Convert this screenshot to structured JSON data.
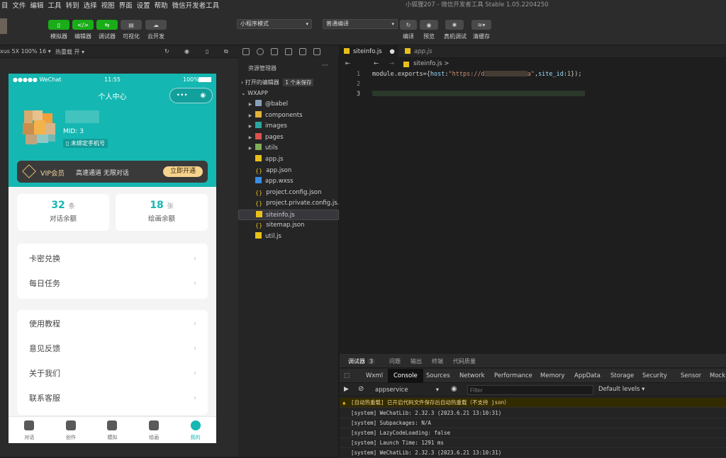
{
  "menubar": {
    "items": [
      "目",
      "文件",
      "编辑",
      "工具",
      "转到",
      "选择",
      "视图",
      "界面",
      "设置",
      "帮助",
      "微信开发者工具"
    ],
    "window_title": "小狐狸207 - 微信开发者工具 Stable 1.05.2204250"
  },
  "toolbar": {
    "simulator": "模拟器",
    "editor": "编辑器",
    "debugger": "调试器",
    "visual": "可视化",
    "cloud": "云开发",
    "mode_select": "小程序模式",
    "compile_select": "普通编译",
    "compile": "编译",
    "preview": "预览",
    "real_debug": "真机调试",
    "clear_cache": "清缓存"
  },
  "simbar": {
    "device": "xus 5X 100% 16 ▾",
    "hotreload": "热重载 开 ▾"
  },
  "phone": {
    "status": {
      "carrier": "●●●●● WeChat",
      "time": "11:55",
      "battery": "100%"
    },
    "title": "个人中心",
    "mid": "MID: 3",
    "bind_phone": "未绑定手机号",
    "vip": {
      "label": "VIP会员",
      "desc": "高速通道 无限对话",
      "button": "立即开通"
    },
    "quota": [
      {
        "num": "32",
        "unit": "条",
        "label": "对话余额"
      },
      {
        "num": "18",
        "unit": "张",
        "label": "绘画余额"
      }
    ],
    "menu_group1": [
      "卡密兑换",
      "每日任务"
    ],
    "menu_group2": [
      "使用教程",
      "意见反馈",
      "关于我们",
      "联系客服"
    ],
    "tabbar": [
      "对话",
      "创作",
      "模拟",
      "绘画",
      "我的"
    ],
    "accent_color": "#15b7b2"
  },
  "explorer": {
    "title": "资源管理器",
    "more": "···",
    "open_editors": "打开的编辑器",
    "unsaved_badge": "1 个未保存",
    "root": "WXAPP",
    "items": [
      {
        "name": "@babel",
        "type": "folder",
        "icon": "folder-icon"
      },
      {
        "name": "components",
        "type": "folder",
        "icon": "components-folder-icon"
      },
      {
        "name": "images",
        "type": "folder",
        "icon": "images-folder-icon"
      },
      {
        "name": "pages",
        "type": "folder",
        "icon": "pages-folder-icon"
      },
      {
        "name": "utils",
        "type": "folder",
        "icon": "utils-folder-icon"
      },
      {
        "name": "app.js",
        "type": "js"
      },
      {
        "name": "app.json",
        "type": "json"
      },
      {
        "name": "app.wxss",
        "type": "wxss"
      },
      {
        "name": "project.config.json",
        "type": "json"
      },
      {
        "name": "project.private.config.js...",
        "type": "json"
      },
      {
        "name": "siteinfo.js",
        "type": "js",
        "selected": true
      },
      {
        "name": "sitemap.json",
        "type": "json"
      },
      {
        "name": "util.js",
        "type": "js"
      }
    ]
  },
  "editor": {
    "tabs": [
      {
        "name": "siteinfo.js",
        "modified": "●"
      },
      {
        "name": "app.js"
      }
    ],
    "breadcrumb": "siteinfo.js >",
    "lines": [
      "1",
      "2",
      "3"
    ],
    "code": {
      "prefix": "module.exports={",
      "host_key": "host",
      "host_val_start": "\"https://d",
      "host_val_end": "a\"",
      "site_key": "site_id",
      "site_val": "1",
      "suffix": "});"
    }
  },
  "debugger": {
    "tabs": {
      "main": "调试器",
      "count": "3",
      "issues": "问题",
      "output": "输出",
      "terminal": "终端",
      "code_quality": "代码质量"
    },
    "subtabs": [
      "Wxml",
      "Console",
      "Sources",
      "Network",
      "Performance",
      "Memory",
      "AppData",
      "Storage",
      "Security",
      "Sensor",
      "Mock"
    ],
    "context": "appservice",
    "filter_placeholder": "Filter",
    "levels": "Default levels ▾",
    "logs": [
      "[自动热重载] 已开启代码文件保存后自动热重载（不支持 json）",
      "[system] WeChatLib: 2.32.3 (2023.6.21 13:10:31)",
      "[system] Subpackages: N/A",
      "[system] LazyCodeLoading: false",
      "[system] Launch Time: 1291 ms",
      "[system] WeChatLib: 2.32.3 (2023.6.21 13:10:31)"
    ]
  }
}
